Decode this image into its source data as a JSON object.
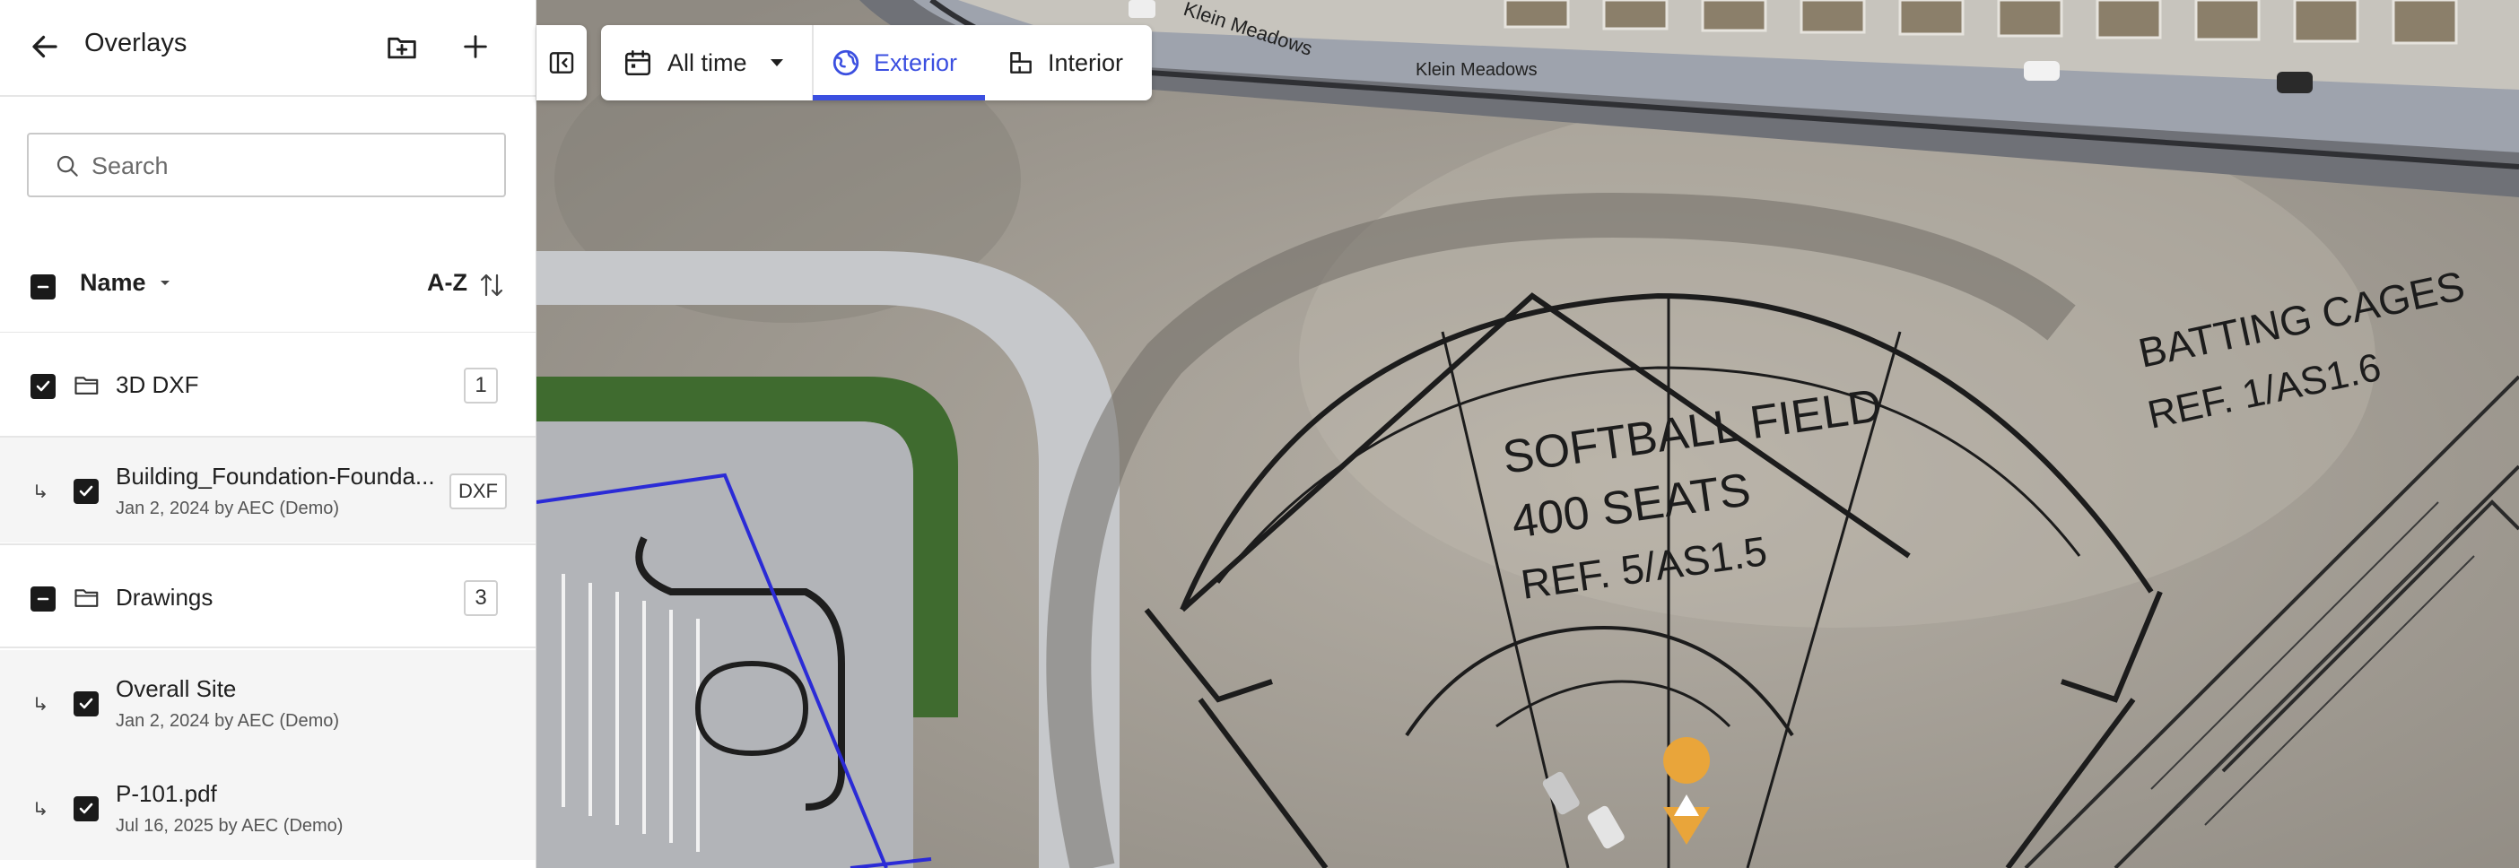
{
  "sidebar": {
    "title": "Overlays",
    "search_placeholder": "Search",
    "list_header": {
      "name_label": "Name",
      "sort_label": "A-Z"
    },
    "rows": [
      {
        "kind": "folder",
        "label": "3D DXF",
        "count": "1",
        "checked": "checked"
      },
      {
        "kind": "child",
        "title": "Building_Foundation-Founda...",
        "subtitle": "Jan 2, 2024 by AEC (Demo)",
        "badge": "DXF",
        "checked": "checked"
      },
      {
        "kind": "folder",
        "label": "Drawings",
        "count": "3",
        "checked": "indeterminate"
      },
      {
        "kind": "child",
        "title": "Overall Site",
        "subtitle": "Jan 2, 2024 by AEC (Demo)",
        "checked": "checked"
      },
      {
        "kind": "child",
        "title": "P-101.pdf",
        "subtitle": "Jul 16, 2025 by AEC (Demo)",
        "checked": "checked"
      }
    ]
  },
  "toolbar": {
    "time_filter": "All time",
    "tabs": [
      {
        "label": "Exterior",
        "active": true,
        "icon": "globe-icon"
      },
      {
        "label": "Interior",
        "active": false,
        "icon": "floorplan-icon"
      }
    ]
  },
  "map": {
    "street_label_1": "Klein Meadows",
    "street_label_2": "Klein Meadows",
    "field_label_1": "SOFTBALL FIELD",
    "field_label_2": "400 SEATS",
    "field_label_3": "REF. 5/AS1.5",
    "cages_label_1": "BATTING CAGES",
    "cages_label_2": "REF. 1/AS1.6",
    "marker_icon": "warning-icon"
  },
  "colors": {
    "accent": "#3b4fe0",
    "marker": "#e9a53a",
    "overlay_line": "#2b2bd6"
  }
}
